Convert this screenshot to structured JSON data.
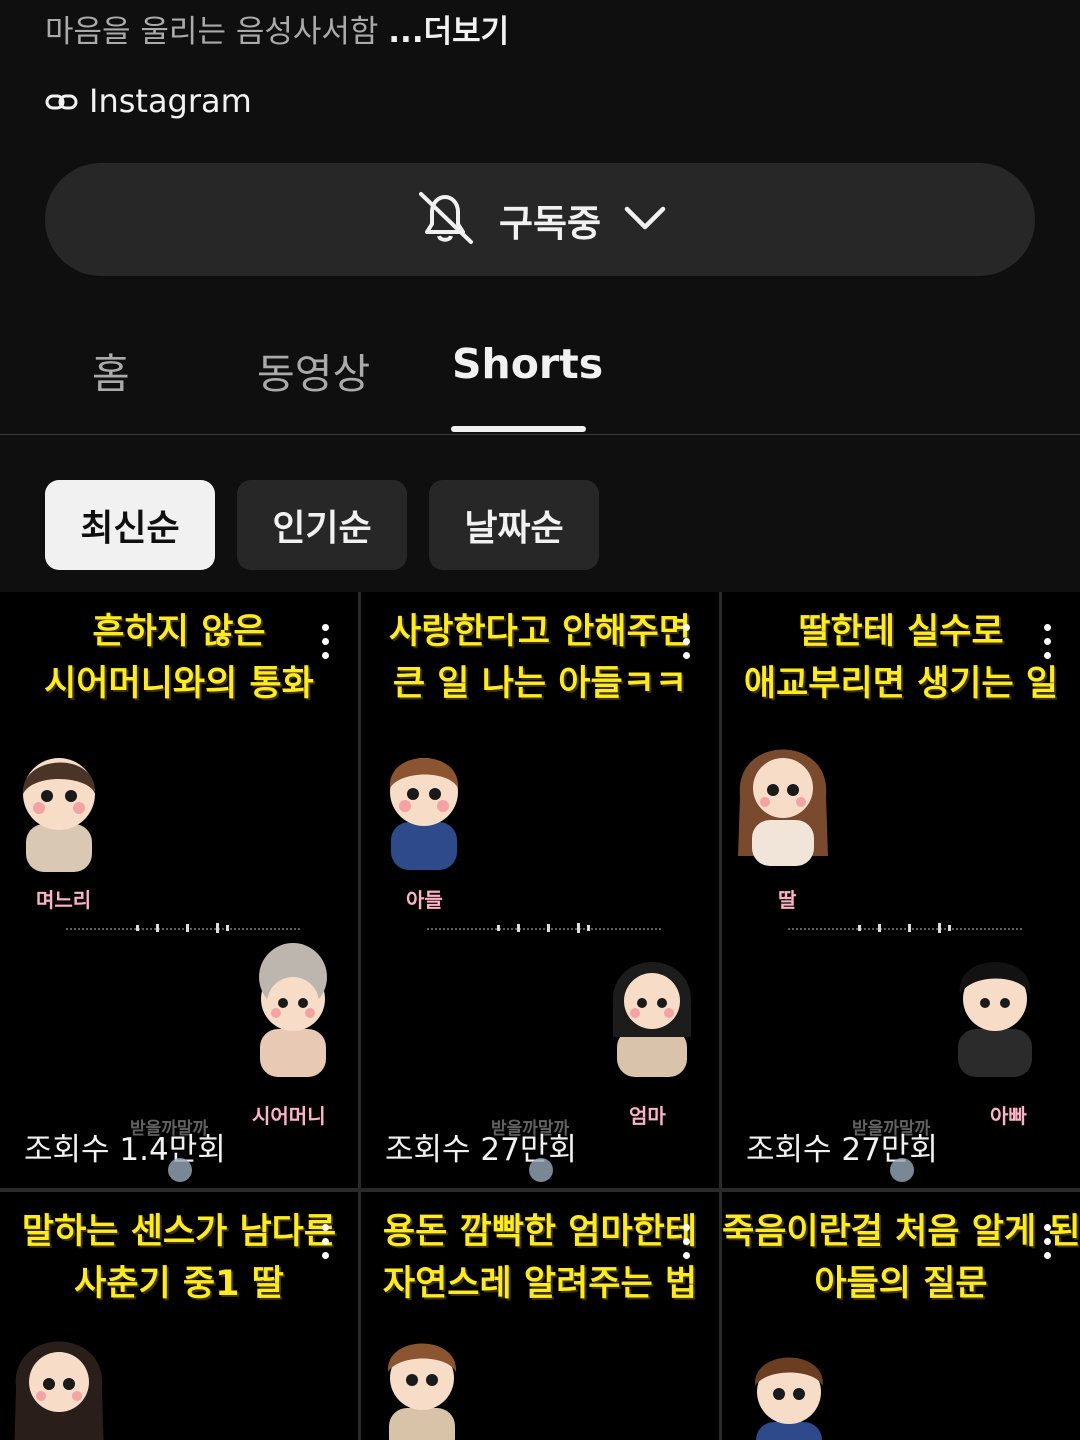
{
  "channel": {
    "description": "마음을 울리는 음성사서함 ",
    "more_label": "...더보기",
    "link_label": "Instagram"
  },
  "subscribe": {
    "label": "구독중"
  },
  "tabs": [
    {
      "label": "홈",
      "active": false
    },
    {
      "label": "동영상",
      "active": false
    },
    {
      "label": "Shorts",
      "active": true
    }
  ],
  "chips": [
    {
      "label": "최신순",
      "active": true
    },
    {
      "label": "인기순",
      "active": false
    },
    {
      "label": "날짜순",
      "active": false
    }
  ],
  "shorts": [
    {
      "title_line1": "흔하지 않은",
      "title_line2": "시어머니와의 통화",
      "caller_top": "며느리",
      "caller_bottom": "시어머니",
      "watermark": "받을까말까",
      "views": "조회수 1.4만회"
    },
    {
      "title_line1": "사랑한다고 안해주면",
      "title_line2": "큰 일 나는 아들ㅋㅋ",
      "caller_top": "아들",
      "caller_bottom": "엄마",
      "watermark": "받을까말까",
      "views": "조회수 27만회"
    },
    {
      "title_line1": "딸한테 실수로",
      "title_line2": "애교부리면 생기는 일",
      "caller_top": "딸",
      "caller_bottom": "아빠",
      "watermark": "받을까말까",
      "views": "조회수 27만회"
    },
    {
      "title_line1": "말하는 센스가 남다른",
      "title_line2": "사춘기 중1 딸"
    },
    {
      "title_line1": "용돈 깜빡한 엄마한테",
      "title_line2": "자연스레 알려주는 법"
    },
    {
      "title_line1": "죽음이란걸 처음 알게 된",
      "title_line2": "아들의 질문"
    }
  ],
  "colors": {
    "background": "#0f0f0f",
    "chip_active": "#f1f1f1",
    "title_yellow": "#ffeb1f",
    "caller_label_pink": "#ffb3c6"
  },
  "icons": {
    "link": "link-icon",
    "bell_off": "bell-off-icon",
    "chevron": "chevron-down-icon",
    "more": "more-vert-icon"
  }
}
